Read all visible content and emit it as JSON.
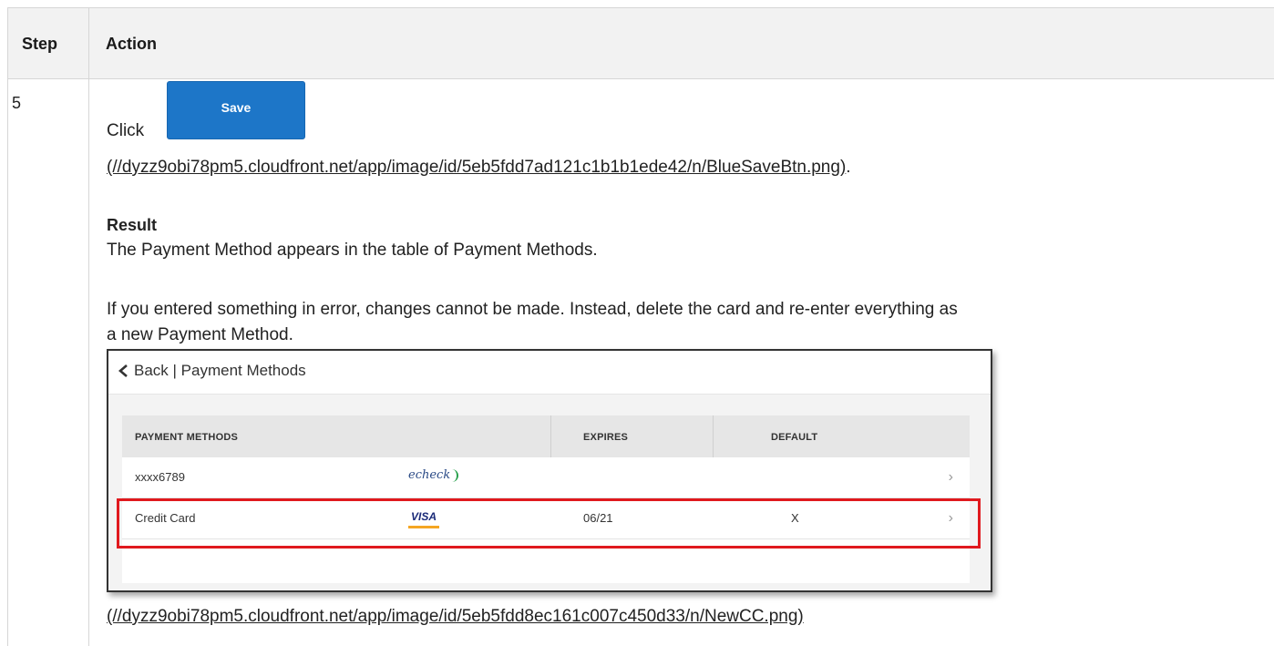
{
  "table": {
    "headers": {
      "step": "Step",
      "action": "Action"
    },
    "step_number": "5"
  },
  "instruction": {
    "click_prefix": "Click",
    "save_button_label": "Save",
    "save_image_link": "(//dyzz9obi78pm5.cloudfront.net/app/image/id/5eb5fdd7ad121c1b1b1ede42/n/BlueSaveBtn.png)",
    "period": "."
  },
  "result": {
    "label": "Result",
    "line1": "The Payment Method appears in the table of Payment Methods.",
    "line2": "If you entered something in error, changes cannot be made. Instead, delete the card and re-enter everything as",
    "line3": "a new Payment Method."
  },
  "screenshot": {
    "back_text": "Back | Payment Methods",
    "columns": [
      "PAYMENT METHODS",
      "EXPIRES",
      "DEFAULT"
    ],
    "rows": [
      {
        "method": "xxxx6789",
        "logo_text": "echeck",
        "expires": "",
        "default": ""
      },
      {
        "method": "Credit Card",
        "logo_text": "VISA",
        "expires": "06/21",
        "default": "X"
      }
    ],
    "chevron": "›",
    "highlight_color": "#e0191e",
    "image_link": "(//dyzz9obi78pm5.cloudfront.net/app/image/id/5eb5fdd8ec161c007c450d33/n/NewCC.png)"
  },
  "colors": {
    "save_button": "#1d76c8",
    "header_bg": "#f2f2f2"
  }
}
